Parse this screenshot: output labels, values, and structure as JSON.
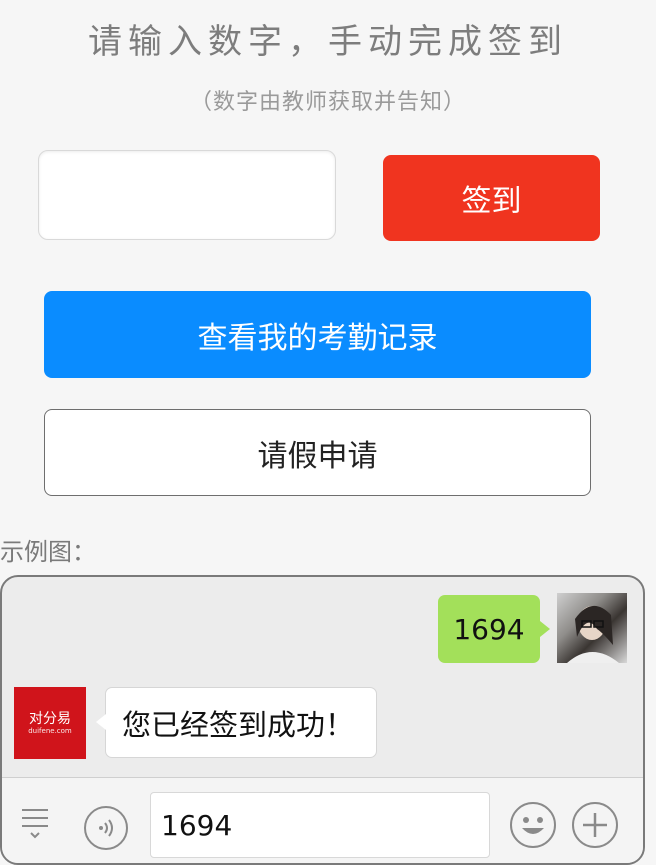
{
  "header": {
    "title": "请输入数字，手动完成签到",
    "subtitle": "（数字由教师获取并告知）"
  },
  "form": {
    "code_value": "",
    "signin_label": "签到"
  },
  "actions": {
    "records_label": "查看我的考勤记录",
    "leave_label": "请假申请"
  },
  "example": {
    "label": "示例图：",
    "sent_message": "1694",
    "reply_message": "您已经签到成功！",
    "bot_logo": "对分易",
    "bot_logo_sub": "duifene.com",
    "input_value": "1694"
  },
  "colors": {
    "signin_button": "#f0341f",
    "records_button": "#0a8cff",
    "sent_bubble": "#a3e05a"
  },
  "icons": [
    "menu-icon",
    "voice-icon",
    "emoji-icon",
    "plus-icon"
  ]
}
